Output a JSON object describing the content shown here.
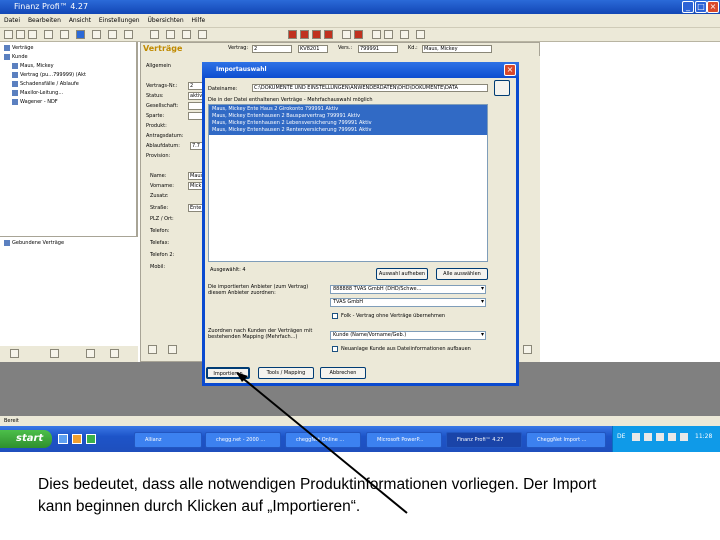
{
  "window": {
    "title": "Finanz Profi™ 4.27",
    "min": "_",
    "max": "□",
    "close": "×"
  },
  "menu": [
    "Datei",
    "Bearbeiten",
    "Ansicht",
    "Einstellungen",
    "Übersichten",
    "Hilfe"
  ],
  "tree": {
    "items": [
      {
        "label": "Verträge"
      },
      {
        "label": "Kunde"
      },
      {
        "label": "Maus, Mickey"
      },
      {
        "label": "Vertrag (pu...799999) (Akt"
      },
      {
        "label": "Schadensfälle / Ablaufe"
      },
      {
        "label": "Maxilor-Leitung..."
      },
      {
        "label": "Wagener - NDF"
      }
    ],
    "section2": "Gebundene Verträge"
  },
  "main": {
    "section_title": "Verträge",
    "header": {
      "vertrag_label": "Vertrag:",
      "vertrag_value": "2",
      "kv_value": "KV8201",
      "vers_label": "Vers.:",
      "vers_value": "799991",
      "kd_label": "Kd.:",
      "kd_value": "Maus, Mickey"
    },
    "tab": "Allgemein",
    "fields": [
      {
        "label": "Vertrags-Nr.:",
        "value": "2"
      },
      {
        "label": "Status:",
        "value": "aktiv"
      },
      {
        "label": "Gesellschaft:",
        "value": ""
      },
      {
        "label": "Sparte:",
        "value": ""
      },
      {
        "label": "Produkt:",
        "value": ""
      }
    ],
    "fields2": [
      {
        "label": "Antragsdatum:",
        "value": ""
      },
      {
        "label": "Ablaufdatum:",
        "value": "7.7"
      },
      {
        "label": "Provision:",
        "value": ""
      }
    ],
    "fields3": [
      {
        "label": "Name:",
        "value": "Maus"
      },
      {
        "label": "Vorname:",
        "value": "Mick"
      },
      {
        "label": "Zusatz:",
        "value": ""
      },
      {
        "label": "Straße:",
        "value": "Ente"
      },
      {
        "label": "PLZ / Ort:",
        "value": ""
      },
      {
        "label": "Telefon:",
        "value": ""
      },
      {
        "label": "Telefax:",
        "value": ""
      },
      {
        "label": "Telefon 2:",
        "value": ""
      },
      {
        "label": "Mobil:",
        "value": ""
      }
    ]
  },
  "dialog": {
    "title": "Importauswahl",
    "close": "×",
    "file_label": "Dateiname:",
    "file_value": "C:\\DOKUMENTE UND EINSTELLUNGEN\\ANWENDERDATEN\\DHD\\DOKUMENTE\\DATA",
    "list_caption": "Die in der Datei enthaltenen Verträge - Mehrfachauswahl möglich",
    "list_items": [
      "Maus, Mickey  Ente Haus  2  Girokonto  799991  Aktiv",
      "Maus, Mickey  Entenhausen  2  Bausparvertrag  799991  Aktiv",
      "Maus, Mickey  Entenhausen  2  Lebensversicherung  799991  Aktiv",
      "Maus, Mickey  Entenhausen  2  Rentenversicherung  799991  Aktiv"
    ],
    "selected_label": "Ausgewählt: 4",
    "btn_select_all": "Auswahl aufheben",
    "btn_select_none": "Alle auswählen",
    "company_label": "Die importierten Anbieter (zum Vertrag) diesem Anbieter zuordnen:",
    "company_value": "888888 TVAS GmbH (DHD/Schwe...",
    "broker_value": "TVAS GmbH",
    "check1_label": "Folk - Vertrag ohne Verträge übernehmen",
    "mapping_label": "Zuordnen nach Kunden der Verträgen mit bestehenden Mapping (Mehrfach...)",
    "mapping_value": "Kunde (Name/Vorname/Geb.)",
    "check2_label": "Neuanlage Kunde aus Dateiinformationen aufbauen",
    "btn_import": "Importieren",
    "btn_mapping": "Tools / Mapping",
    "btn_cancel": "Abbrechen"
  },
  "statusbar": "Bereit",
  "taskbar": {
    "start": "start",
    "tasks": [
      "Allianz",
      "chegg.net - 2000 ...",
      "cheggNet Online ...",
      "Microsoft PowerP...",
      "Finanz Profi™ 4.27",
      "CheggNet Import ..."
    ],
    "lang": "DE",
    "time": "11:28"
  },
  "caption": {
    "line1": "Dies bedeutet, dass alle notwendigen Produktinformationen vorliegen. Der Import",
    "line2": "kann beginnen durch Klicken auf „Importieren“."
  },
  "colors": {
    "title_blue": "#1246b5",
    "selection_blue": "#316ac5",
    "start_green": "#2f8f2d",
    "accent_gold": "#c08a00"
  }
}
